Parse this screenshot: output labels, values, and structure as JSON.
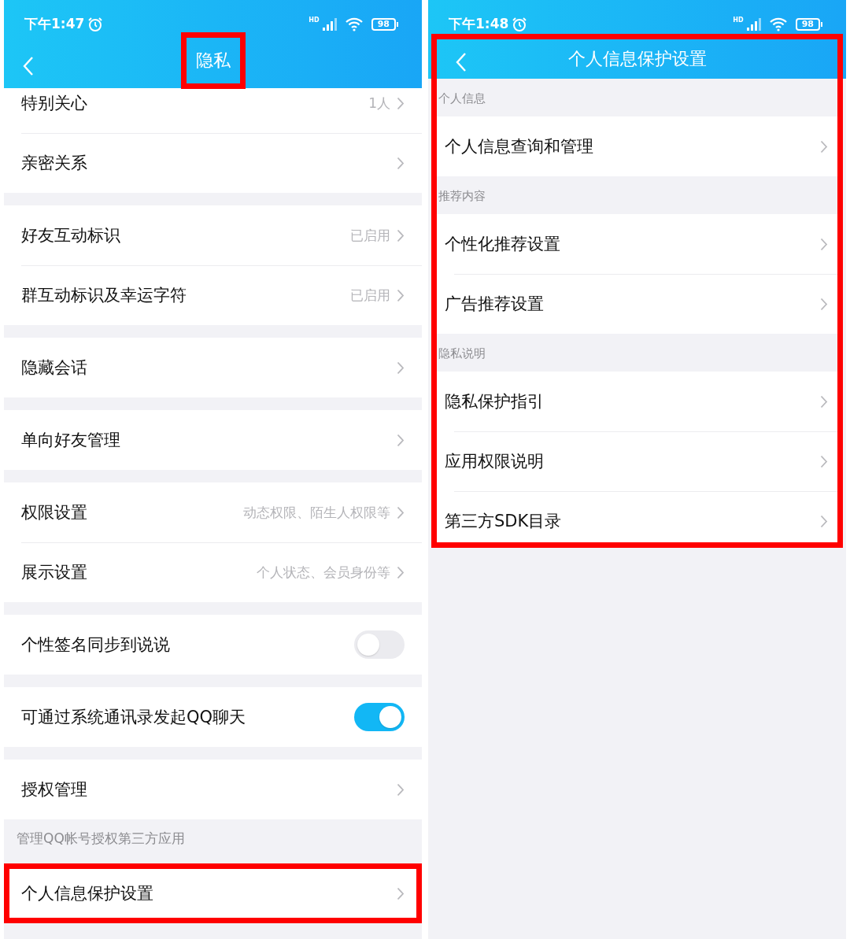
{
  "screens": [
    {
      "status_bar": {
        "time": "下午1:47",
        "network": "HD",
        "battery": "98"
      },
      "header": {
        "title": "隐私",
        "highlighted": true,
        "boxed": false
      },
      "scrolled": true,
      "groups": [
        {
          "items": [
            {
              "kind": "link",
              "label": "特别关心",
              "value": "1人",
              "highlighted": false
            },
            {
              "kind": "link",
              "label": "亲密关系",
              "highlighted": false
            }
          ]
        },
        {
          "items": [
            {
              "kind": "link",
              "label": "好友互动标识",
              "value": "已启用",
              "highlighted": false
            },
            {
              "kind": "link",
              "label": "群互动标识及幸运字符",
              "value": "已启用",
              "highlighted": false
            }
          ]
        },
        {
          "items": [
            {
              "kind": "link",
              "label": "隐藏会话",
              "highlighted": false
            }
          ]
        },
        {
          "items": [
            {
              "kind": "link",
              "label": "单向好友管理",
              "highlighted": false
            }
          ]
        },
        {
          "items": [
            {
              "kind": "link",
              "label": "权限设置",
              "value": "动态权限、陌生人权限等",
              "highlighted": false
            },
            {
              "kind": "link",
              "label": "展示设置",
              "value": "个人状态、会员身份等",
              "highlighted": false
            }
          ]
        },
        {
          "items": [
            {
              "kind": "toggle",
              "label": "个性签名同步到说说",
              "on": false,
              "highlighted": false
            }
          ]
        },
        {
          "items": [
            {
              "kind": "toggle",
              "label": "可通过系统通讯录发起QQ聊天",
              "on": true,
              "highlighted": false
            }
          ]
        },
        {
          "items": [
            {
              "kind": "link",
              "label": "授权管理",
              "highlighted": false
            }
          ],
          "footer": "管理QQ帐号授权第三方应用"
        },
        {
          "items": [
            {
              "kind": "link",
              "label": "个人信息保护设置",
              "highlighted": true
            }
          ]
        }
      ]
    },
    {
      "status_bar": {
        "time": "下午1:48",
        "network": "HD",
        "battery": "98"
      },
      "header": {
        "title": "个人信息保护设置",
        "highlighted": false,
        "boxed": true
      },
      "scrolled": false,
      "groups": [
        {
          "header": "个人信息",
          "items": [
            {
              "kind": "link",
              "label": "个人信息查询和管理",
              "highlighted": false
            }
          ]
        },
        {
          "header": "推荐内容",
          "items": [
            {
              "kind": "link",
              "label": "个性化推荐设置",
              "highlighted": false
            },
            {
              "kind": "link",
              "label": "广告推荐设置",
              "highlighted": false
            }
          ]
        },
        {
          "header": "隐私说明",
          "items": [
            {
              "kind": "link",
              "label": "隐私保护指引",
              "highlighted": false
            },
            {
              "kind": "link",
              "label": "应用权限说明",
              "highlighted": false
            },
            {
              "kind": "link",
              "label": "第三方SDK目录",
              "highlighted": false
            }
          ]
        }
      ]
    }
  ]
}
